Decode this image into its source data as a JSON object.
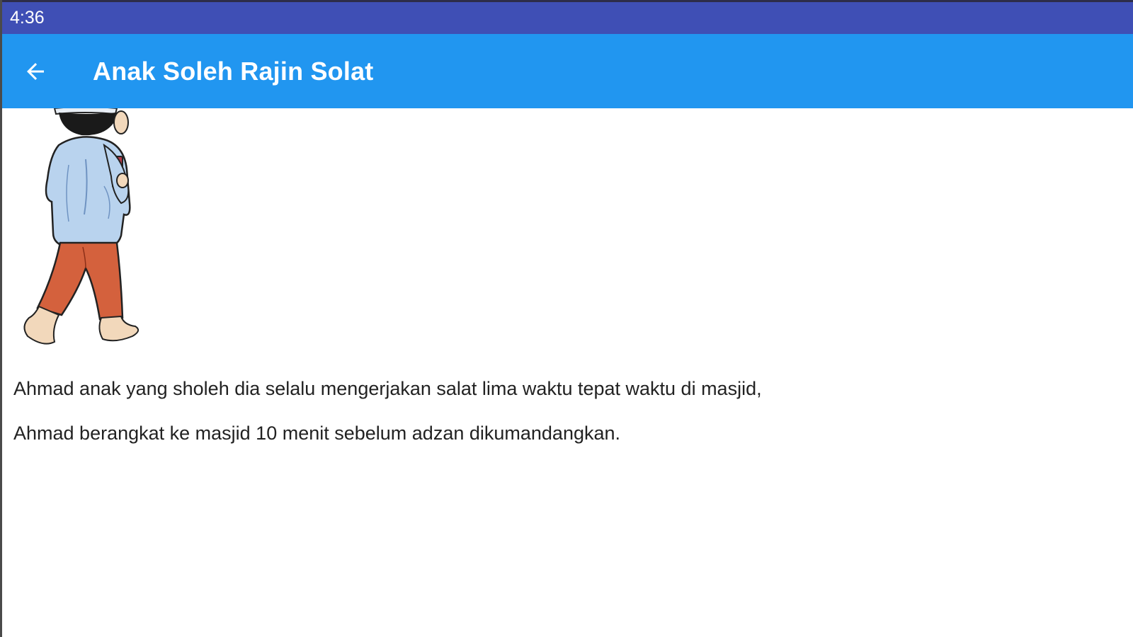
{
  "status_bar": {
    "time": "4:36"
  },
  "app_bar": {
    "back_icon": "arrow-left-icon",
    "title": "Anak Soleh Rajin Solat"
  },
  "content": {
    "illustration": "boy-walking-to-mosque",
    "paragraphs": [
      "Ahmad anak yang sholeh dia selalu mengerjakan salat lima waktu tepat waktu di masjid,",
      "Ahmad berangkat ke masjid 10 menit sebelum adzan dikumandangkan."
    ]
  },
  "colors": {
    "status_bar": "#3f4fb5",
    "app_bar": "#2196f0",
    "shirt": "#b9d3ee",
    "pants": "#d4613d"
  }
}
